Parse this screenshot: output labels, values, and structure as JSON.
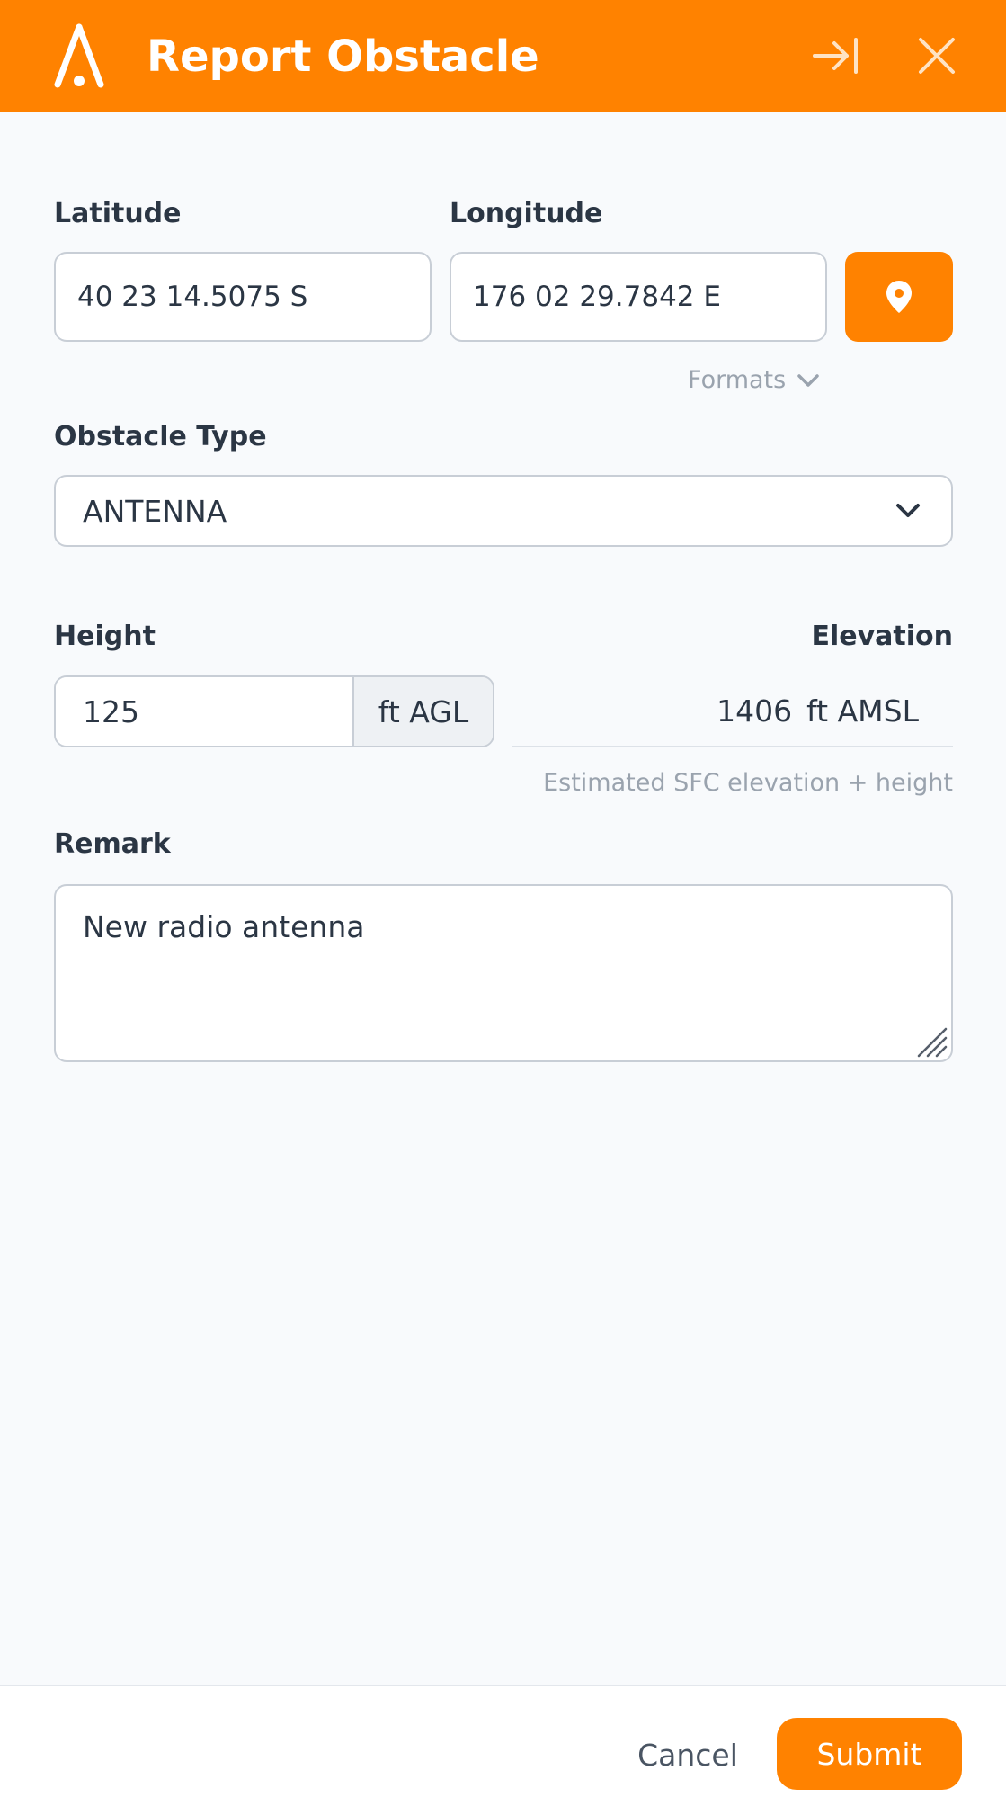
{
  "header": {
    "title": "Report Obstacle",
    "logo_icon": "aero-logo-icon",
    "collapse_icon": "arrow-right-to-bar-icon",
    "close_icon": "close-icon",
    "color": "#ff8200"
  },
  "coordinates": {
    "latitude_label": "Latitude",
    "latitude_value": "40 23 14.5075 S",
    "longitude_label": "Longitude",
    "longitude_value": "176 02 29.7842 E",
    "locate_icon": "map-pin-icon",
    "formats_label": "Formats"
  },
  "obstacle_type": {
    "label": "Obstacle Type",
    "selected": "ANTENNA"
  },
  "height": {
    "label": "Height",
    "value": "125",
    "unit": "ft AGL"
  },
  "elevation": {
    "label": "Elevation",
    "value": "1406",
    "unit": "ft AMSL",
    "hint": "Estimated SFC elevation + height"
  },
  "remark": {
    "label": "Remark",
    "value": "New radio antenna"
  },
  "footer": {
    "cancel_label": "Cancel",
    "submit_label": "Submit"
  }
}
